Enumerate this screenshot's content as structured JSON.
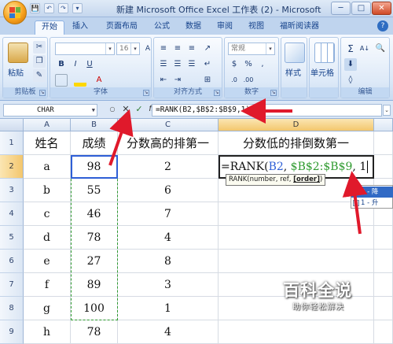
{
  "window": {
    "title": "新建 Microsoft Office Excel 工作表 (2) - Microsoft",
    "buttons": {
      "minimize": "─",
      "maximize": "□",
      "close": "✕"
    }
  },
  "quick_access": {
    "save": "💾",
    "undo": "↶",
    "redo": "↷",
    "more": "▾"
  },
  "ribbon": {
    "tabs": [
      "开始",
      "插入",
      "页面布局",
      "公式",
      "数据",
      "审阅",
      "视图",
      "福昕阅读器"
    ],
    "active_tab": "开始",
    "help": "?",
    "groups": {
      "clipboard": {
        "label": "剪贴板",
        "paste": "粘贴"
      },
      "font": {
        "label": "字体",
        "font_name": "",
        "font_size": "16",
        "bold": "B",
        "italic": "I",
        "underline": "U",
        "font_color": "A",
        "grow": "A",
        "shrink": "A"
      },
      "alignment": {
        "label": "对齐方式"
      },
      "number": {
        "label": "数字",
        "format": "常规",
        "percent": "%",
        "comma": ",",
        "currency": "$"
      },
      "styles": {
        "label": "",
        "style": "样式"
      },
      "cells": {
        "label": "",
        "cells": "单元格"
      },
      "editing": {
        "label": "编辑",
        "sum": "Σ",
        "sort": "A↓"
      }
    }
  },
  "formula_bar": {
    "name_box": "CHAR",
    "cancel": "✕",
    "enter": "✓",
    "fx": "fx",
    "formula": "=RANK(B2,$B$2:$B$9,1)"
  },
  "sheet": {
    "columns": [
      "A",
      "B",
      "C",
      "D"
    ],
    "rows": [
      "1",
      "2",
      "3",
      "4",
      "5",
      "6",
      "7",
      "8",
      "9"
    ],
    "header": [
      "姓名",
      "成绩",
      "分数高的排第一",
      "分数低的排倒数第一"
    ],
    "data": [
      [
        "a",
        "98",
        "2"
      ],
      [
        "b",
        "55",
        "6"
      ],
      [
        "c",
        "46",
        "7"
      ],
      [
        "d",
        "78",
        "4"
      ],
      [
        "e",
        "27",
        "8"
      ],
      [
        "f",
        "89",
        "3"
      ],
      [
        "g",
        "100",
        "1"
      ],
      [
        "h",
        "78",
        "4"
      ]
    ],
    "editing_cell": {
      "prefix": "=RANK(",
      "ref1": "B2",
      "comma1": ", ",
      "ref2": "$B$2:$B$9",
      "rest": ", 1"
    }
  },
  "tooltip": {
    "pre": "RANK(number, ref, ",
    "bold": "[order]",
    "post": ")"
  },
  "autocomplete": [
    "0 - 降",
    "1 - 升"
  ],
  "watermark": {
    "main": "百科全说",
    "sub": "助你轻松解决"
  },
  "colors": {
    "arrow": "#e0192b",
    "accent": "#2e5fd6",
    "range": "#2e9a2e"
  }
}
